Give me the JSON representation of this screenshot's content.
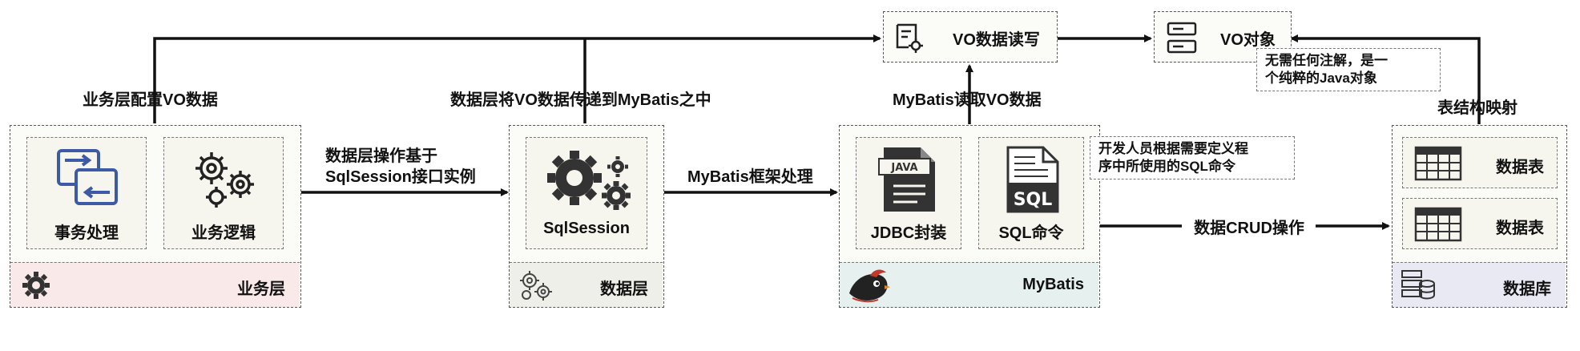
{
  "labels": {
    "business_config": "业务层配置VO数据",
    "data_transfer": "数据层将VO数据传递到MyBatis之中",
    "mybatis_read": "MyBatis读取VO数据",
    "table_mapping": "表结构映射",
    "data_op_line1": "数据层操作基于",
    "data_op_line2": "SqlSession接口实例",
    "framework": "MyBatis框架处理",
    "crud": "数据CRUD操作"
  },
  "top": {
    "vo_rw": "VO数据读写",
    "vo_object": "VO对象",
    "vo_note_line1": "无需任何注解，是一",
    "vo_note_line2": "个纯粹的Java对象"
  },
  "business_layer": {
    "card1": "事务处理",
    "card2": "业务逻辑",
    "footer": "业务层"
  },
  "data_layer": {
    "card": "SqlSession",
    "footer": "数据层"
  },
  "mybatis": {
    "card1": "JDBC封装",
    "card2": "SQL命令",
    "java_tag": "JAVA",
    "sql_tag": "SQL",
    "footer": "MyBatis",
    "note_line1": "开发人员根据需要定义程",
    "note_line2": "序中所使用的SQL命令"
  },
  "database": {
    "table1": "数据表",
    "table2": "数据表",
    "footer": "数据库"
  },
  "colors": {
    "business_footer": "#f9e9e9",
    "data_footer": "#efefe9",
    "mybatis_footer": "#e6f0ee",
    "database_footer": "#e9e9f4",
    "accent_blue": "#3d5aa6"
  }
}
